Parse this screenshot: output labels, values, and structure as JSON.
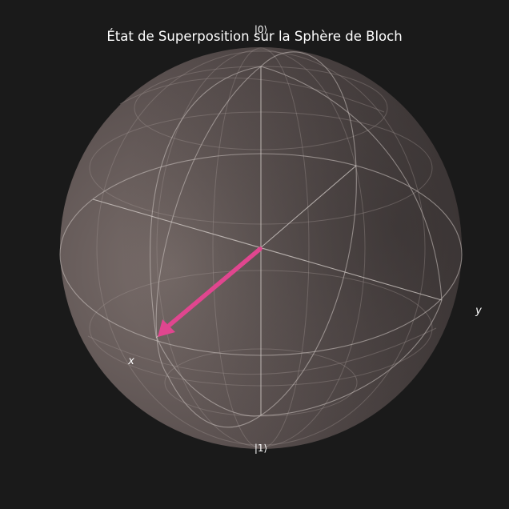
{
  "title": "État de Superposition sur la Sphère de Bloch",
  "labels": {
    "ket0": "|0⟩",
    "ket1": "|1⟩",
    "x_axis": "x",
    "y_axis": "y"
  },
  "colors": {
    "background": "#1a1a1a",
    "sphere": "#6e6260",
    "grid": "#b9b1ae",
    "axes": "#d4cdca",
    "state_vector": "#e0468f",
    "text": "#ffffff"
  }
}
